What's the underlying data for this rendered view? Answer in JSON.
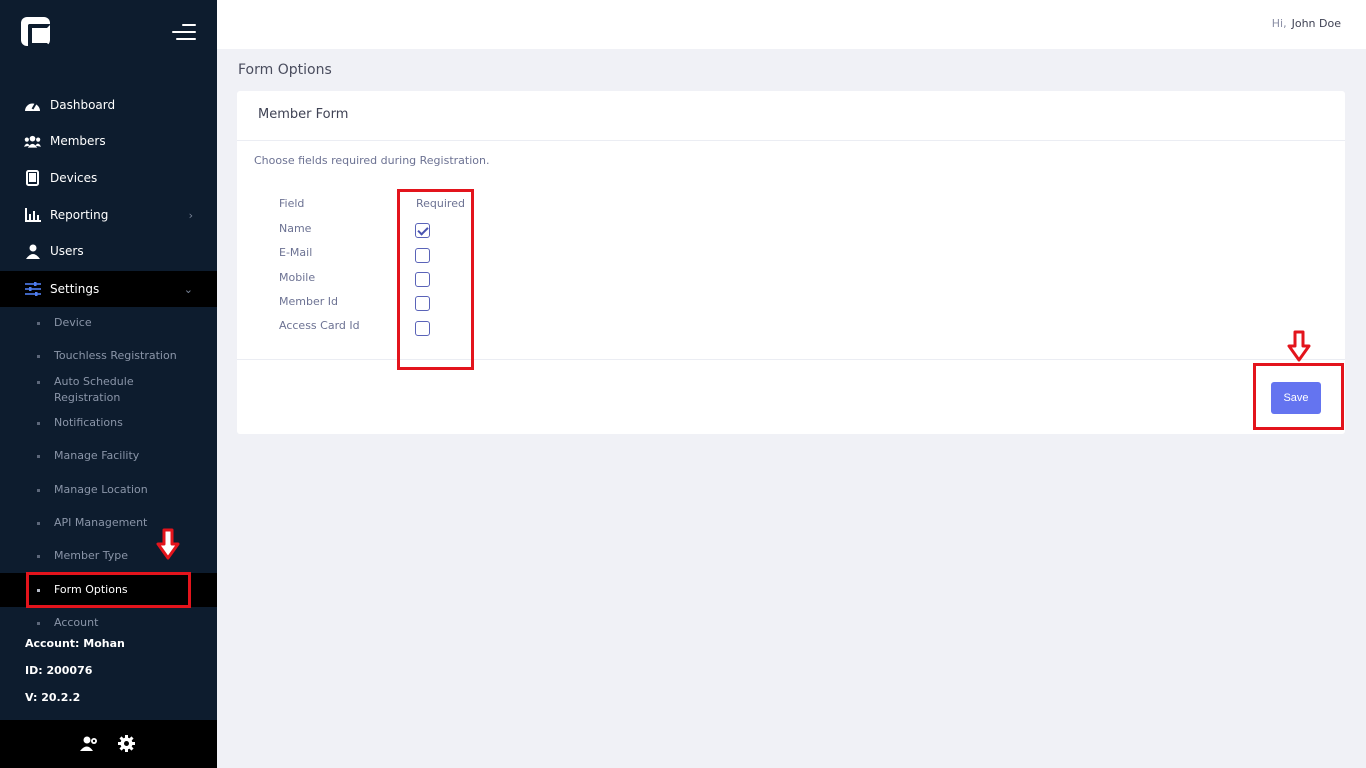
{
  "sidebar": {
    "nav": [
      {
        "label": "Dashboard",
        "icon": "dashboard-icon"
      },
      {
        "label": "Members",
        "icon": "members-icon"
      },
      {
        "label": "Devices",
        "icon": "tablet-icon"
      },
      {
        "label": "Reporting",
        "icon": "chart-icon"
      },
      {
        "label": "Users",
        "icon": "user-icon"
      },
      {
        "label": "Settings",
        "icon": "sliders-icon"
      }
    ],
    "sub_items": [
      {
        "label": "Device"
      },
      {
        "label": "Touchless Registration"
      },
      {
        "label": "Auto Schedule Registration"
      },
      {
        "label": "Notifications"
      },
      {
        "label": "Manage Facility"
      },
      {
        "label": "Manage Location"
      },
      {
        "label": "API Management"
      },
      {
        "label": "Member Type"
      },
      {
        "label": "Form Options"
      },
      {
        "label": "Account"
      }
    ],
    "account": "Account: Mohan",
    "id": "ID: 200076",
    "version": "V: 20.2.2"
  },
  "header": {
    "hi": "Hi,",
    "user": "John Doe"
  },
  "page_title": "Form Options",
  "card": {
    "title": "Member Form",
    "description": "Choose fields required during Registration.",
    "col_field": "Field",
    "col_required": "Required",
    "fields": [
      {
        "label": "Name",
        "required": true
      },
      {
        "label": "E-Mail",
        "required": false
      },
      {
        "label": "Mobile",
        "required": false
      },
      {
        "label": "Member Id",
        "required": false
      },
      {
        "label": "Access Card Id",
        "required": false
      }
    ],
    "save_label": "Save"
  },
  "colors": {
    "sidebar_bg": "#0d1c2e",
    "accent": "#6474f0",
    "annotation": "#e3141c"
  }
}
